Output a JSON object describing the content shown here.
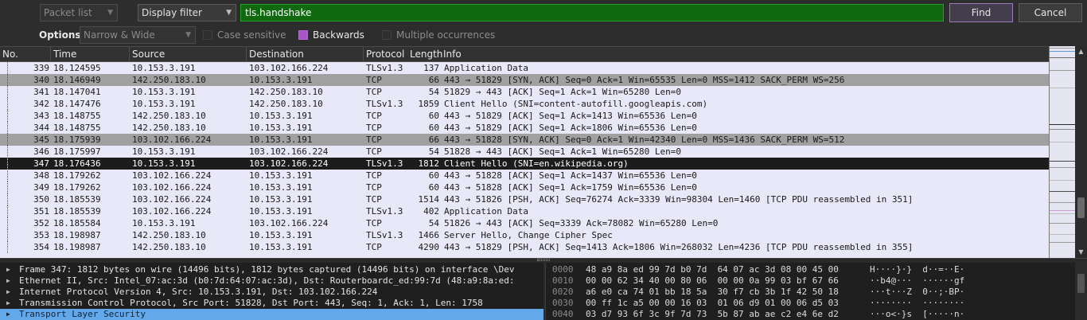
{
  "findbar": {
    "search_in": "Packet list",
    "search_type": "Display filter",
    "query": "tls.handshake",
    "find_label": "Find",
    "cancel_label": "Cancel",
    "options_label": "Options:",
    "char_width": "Narrow & Wide",
    "case_sensitive": "Case sensitive",
    "backwards": "Backwards",
    "multiple": "Multiple occurrences"
  },
  "columns": [
    "No.",
    "Time",
    "Source",
    "Destination",
    "Protocol",
    "Length",
    "Info"
  ],
  "packets": [
    {
      "no": "339",
      "time": "18.124595",
      "src": "10.153.3.191",
      "dst": "103.102.166.224",
      "proto": "TLSv1.3",
      "len": "137",
      "info": "Application Data",
      "state": "normal"
    },
    {
      "no": "340",
      "time": "18.146949",
      "src": "142.250.183.10",
      "dst": "10.153.3.191",
      "proto": "TCP",
      "len": "66",
      "info": "443 → 51829 [SYN, ACK] Seq=0 Ack=1 Win=65535 Len=0 MSS=1412 SACK_PERM WS=256",
      "state": "highlight"
    },
    {
      "no": "341",
      "time": "18.147041",
      "src": "10.153.3.191",
      "dst": "142.250.183.10",
      "proto": "TCP",
      "len": "54",
      "info": "51829 → 443 [ACK] Seq=1 Ack=1 Win=65280 Len=0",
      "state": "normal"
    },
    {
      "no": "342",
      "time": "18.147476",
      "src": "10.153.3.191",
      "dst": "142.250.183.10",
      "proto": "TLSv1.3",
      "len": "1859",
      "info": "Client Hello (SNI=content-autofill.googleapis.com)",
      "state": "normal"
    },
    {
      "no": "343",
      "time": "18.148755",
      "src": "142.250.183.10",
      "dst": "10.153.3.191",
      "proto": "TCP",
      "len": "60",
      "info": "443 → 51829 [ACK] Seq=1 Ack=1413 Win=65536 Len=0",
      "state": "normal"
    },
    {
      "no": "344",
      "time": "18.148755",
      "src": "142.250.183.10",
      "dst": "10.153.3.191",
      "proto": "TCP",
      "len": "60",
      "info": "443 → 51829 [ACK] Seq=1 Ack=1806 Win=65536 Len=0",
      "state": "normal"
    },
    {
      "no": "345",
      "time": "18.175939",
      "src": "103.102.166.224",
      "dst": "10.153.3.191",
      "proto": "TCP",
      "len": "66",
      "info": "443 → 51828 [SYN, ACK] Seq=0 Ack=1 Win=42340 Len=0 MSS=1436 SACK_PERM WS=512",
      "state": "highlight"
    },
    {
      "no": "346",
      "time": "18.175997",
      "src": "10.153.3.191",
      "dst": "103.102.166.224",
      "proto": "TCP",
      "len": "54",
      "info": "51828 → 443 [ACK] Seq=1 Ack=1 Win=65280 Len=0",
      "state": "normal"
    },
    {
      "no": "347",
      "time": "18.176436",
      "src": "10.153.3.191",
      "dst": "103.102.166.224",
      "proto": "TLSv1.3",
      "len": "1812",
      "info": "Client Hello (SNI=en.wikipedia.org)",
      "state": "selected"
    },
    {
      "no": "348",
      "time": "18.179262",
      "src": "103.102.166.224",
      "dst": "10.153.3.191",
      "proto": "TCP",
      "len": "60",
      "info": "443 → 51828 [ACK] Seq=1 Ack=1437 Win=65536 Len=0",
      "state": "normal"
    },
    {
      "no": "349",
      "time": "18.179262",
      "src": "103.102.166.224",
      "dst": "10.153.3.191",
      "proto": "TCP",
      "len": "60",
      "info": "443 → 51828 [ACK] Seq=1 Ack=1759 Win=65536 Len=0",
      "state": "normal"
    },
    {
      "no": "350",
      "time": "18.185539",
      "src": "103.102.166.224",
      "dst": "10.153.3.191",
      "proto": "TCP",
      "len": "1514",
      "info": "443 → 51826 [PSH, ACK] Seq=76274 Ack=3339 Win=98304 Len=1460 [TCP PDU reassembled in 351]",
      "state": "normal"
    },
    {
      "no": "351",
      "time": "18.185539",
      "src": "103.102.166.224",
      "dst": "10.153.3.191",
      "proto": "TLSv1.3",
      "len": "402",
      "info": "Application Data",
      "state": "normal"
    },
    {
      "no": "352",
      "time": "18.185584",
      "src": "10.153.3.191",
      "dst": "103.102.166.224",
      "proto": "TCP",
      "len": "54",
      "info": "51826 → 443 [ACK] Seq=3339 Ack=78082 Win=65280 Len=0",
      "state": "normal"
    },
    {
      "no": "353",
      "time": "18.198987",
      "src": "142.250.183.10",
      "dst": "10.153.3.191",
      "proto": "TLSv1.3",
      "len": "1466",
      "info": "Server Hello, Change Cipher Spec",
      "state": "normal"
    },
    {
      "no": "354",
      "time": "18.198987",
      "src": "142.250.183.10",
      "dst": "10.153.3.191",
      "proto": "TCP",
      "len": "4290",
      "info": "443 → 51829 [PSH, ACK] Seq=1413 Ack=1806 Win=268032 Len=4236 [TCP PDU reassembled in 355]",
      "state": "normal"
    }
  ],
  "details": [
    {
      "text": "Frame 347: 1812 bytes on wire (14496 bits), 1812 bytes captured (14496 bits) on interface \\Dev",
      "selected": false
    },
    {
      "text": "Ethernet II, Src: Intel_07:ac:3d (b0:7d:64:07:ac:3d), Dst: Routerboardc_ed:99:7d (48:a9:8a:ed:",
      "selected": false
    },
    {
      "text": "Internet Protocol Version 4, Src: 10.153.3.191, Dst: 103.102.166.224",
      "selected": false
    },
    {
      "text": "Transmission Control Protocol, Src Port: 51828, Dst Port: 443, Seq: 1, Ack: 1, Len: 1758",
      "selected": false
    },
    {
      "text": "Transport Layer Security",
      "selected": true
    }
  ],
  "bytes": [
    {
      "offset": "0000",
      "hex": "48 a9 8a ed 99 7d b0 7d  64 07 ac 3d 08 00 45 00",
      "ascii": "H····}·}  d··=··E·"
    },
    {
      "offset": "0010",
      "hex": "00 00 62 34 40 00 80 06  00 00 0a 99 03 bf 67 66",
      "ascii": "··b4@···  ······gf"
    },
    {
      "offset": "0020",
      "hex": "a6 e0 ca 74 01 bb 18 5a  30 f7 cb 3b 1f 42 50 18",
      "ascii": "···t···Z  0··;·BP·"
    },
    {
      "offset": "0030",
      "hex": "00 ff 1c a5 00 00 16 03  01 06 d9 01 00 06 d5 03",
      "ascii": "········  ········"
    },
    {
      "offset": "0040",
      "hex": "03 d7 93 6f 3c 9f 7d 73  5b 87 ab ae c2 e4 6e d2",
      "ascii": "···o<·}s  [·····n·"
    }
  ],
  "colors": {
    "tcp_handshake": "#a0a0a0",
    "selected_row": "#1c1c1c",
    "list_bg": "#e8e8f8",
    "filter_valid": "#0f6a0f",
    "detail_selected": "#63a8e8",
    "checkbox_on": "#a855c8"
  },
  "icons": {
    "dropdown": "chevron-down-icon",
    "expand": "triangle-right-icon",
    "scroll_up": "arrow-up-icon",
    "scroll_down": "arrow-down-icon"
  }
}
